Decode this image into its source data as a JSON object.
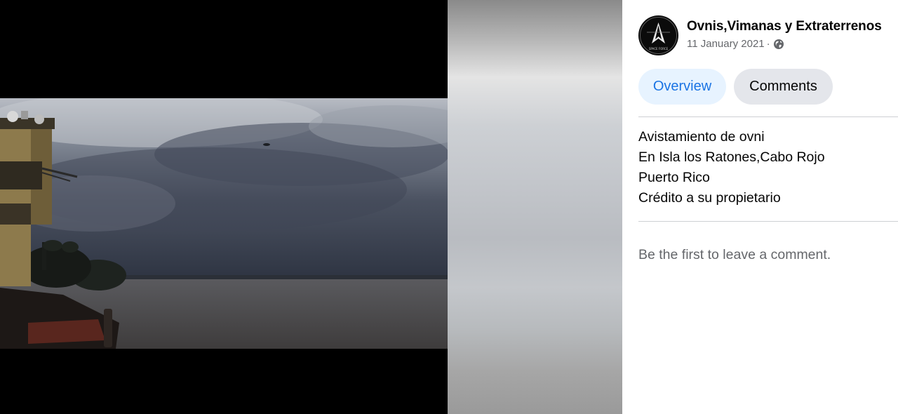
{
  "post": {
    "page_name": "Ovnis,Vimanas y Extraterrenos",
    "date": "11 January 2021",
    "separator": "·",
    "audience_icon": "globe-icon",
    "avatar_text": "SPACE FORCE"
  },
  "tabs": [
    {
      "label": "Overview",
      "active": true
    },
    {
      "label": "Comments",
      "active": false
    }
  ],
  "description": [
    "Avistamiento de ovni",
    "En Isla los Ratones,Cabo Rojo",
    "Puerto Rico",
    "Crédito a su propietario"
  ],
  "comments": {
    "empty_text": "Be the first to leave a comment."
  },
  "colors": {
    "accent": "#1b74e4",
    "active_tab_bg": "#e7f3ff",
    "inactive_tab_bg": "#e4e6eb",
    "secondary_text": "#65676b"
  }
}
